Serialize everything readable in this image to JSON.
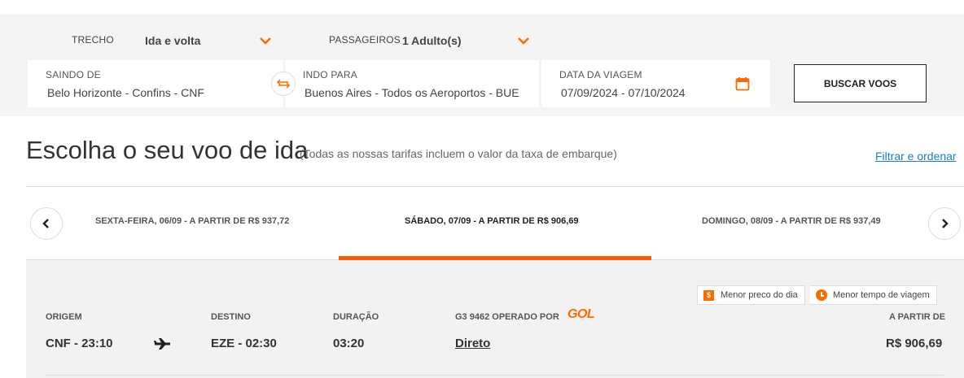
{
  "search": {
    "trip_label": "TRECHO",
    "trip_value": "Ida e volta",
    "passengers_label": "PASSAGEIROS",
    "passengers_value": "1 Adulto(s)",
    "origin_label": "SAINDO DE",
    "origin_value": "Belo Horizonte  -  Confins - CNF",
    "destination_label": "INDO PARA",
    "destination_value": "Buenos Aires - Todos os Aeroportos - BUE",
    "date_label": "DATA DA VIAGEM",
    "date_value": "07/09/2024  -  07/10/2024",
    "search_button": "BUSCAR VOOS"
  },
  "heading": {
    "title": "Escolha o seu voo de ida",
    "subtitle": "(Todas as nossas tarifas incluem o valor da taxa de embarque)",
    "filter_link": "Filtrar e ordenar"
  },
  "date_tabs": [
    {
      "label": "SEXTA-FEIRA, 06/09 - A PARTIR DE R$ 937,72",
      "active": false
    },
    {
      "label": "SÁBADO, 07/09 - A PARTIR DE R$ 906,69",
      "active": true
    },
    {
      "label": "DOMINGO, 08/09 - A PARTIR DE R$ 937,49",
      "active": false
    }
  ],
  "flight": {
    "badges": {
      "cheapest": "Menor preco do dia",
      "fastest": "Menor tempo de viagem",
      "cheapest_icon_text": "$"
    },
    "origin_label": "ORIGEM",
    "origin_value": "CNF - 23:10",
    "destination_label": "DESTINO",
    "destination_value": "EZE - 02:30",
    "duration_label": "DURAÇÃO",
    "duration_value": "03:20",
    "operator_label": "G3 9462 OPERADO POR",
    "operator_logo": "GOL",
    "stops_value": "Direto",
    "price_label": "A PARTIR DE",
    "price_value": "R$ 906,69"
  },
  "colors": {
    "accent": "#ff6a00",
    "link": "#1d7ec2",
    "panel_bg": "#f4f4f4"
  },
  "icons": [
    "chevron-down-icon",
    "swap-icon",
    "calendar-icon",
    "chevron-left-icon",
    "chevron-right-icon",
    "airplane-icon",
    "dollar-icon",
    "clock-icon"
  ]
}
